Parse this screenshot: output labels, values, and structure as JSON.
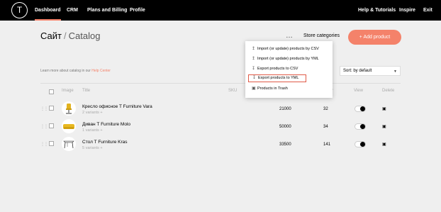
{
  "nav": {
    "logo": "T",
    "items": [
      "Dashboard",
      "CRM",
      "Plans and Billing",
      "Profile"
    ],
    "right": [
      "Help & Tutorials",
      "Inspire",
      "Exit"
    ]
  },
  "header": {
    "site": "Сайт",
    "separator": "/",
    "page": "Catalog",
    "more": "…",
    "store_categories": "Store categories",
    "add_product": "+ Add product"
  },
  "learn": {
    "prefix": "Learn more about catalog in our",
    "link": "Help Center"
  },
  "sort": {
    "value": "Sort: by default"
  },
  "table": {
    "headers": {
      "image": "Image",
      "title": "Title",
      "sku": "SKU",
      "quantity": "tity",
      "view": "View",
      "delete": "Delete"
    },
    "rows": [
      {
        "title": "Кресло офисное T Furniture Vara",
        "variants": "2 variants +",
        "price": "21000",
        "qty": "32"
      },
      {
        "title": "Диван T Furniture Molo",
        "variants": "1 variants +",
        "price": "50000",
        "qty": "34"
      },
      {
        "title": "Стол T Furniture Kras",
        "variants": "5 variants +",
        "price": "33500",
        "qty": "141"
      }
    ]
  },
  "dropdown": {
    "items": [
      {
        "label": "Import (or update) products by CSV",
        "icon": "upload-icon"
      },
      {
        "label": "Import (or update) products by YML",
        "icon": "upload-icon"
      },
      {
        "label": "Export products to CSV",
        "icon": "download-icon"
      },
      {
        "label": "Export products to YML",
        "icon": "download-icon"
      },
      {
        "label": "Products in Trash",
        "icon": "trash-icon"
      }
    ]
  },
  "colors": {
    "accent": "#f4826a",
    "topbar": "#000000",
    "background": "#efefef"
  }
}
